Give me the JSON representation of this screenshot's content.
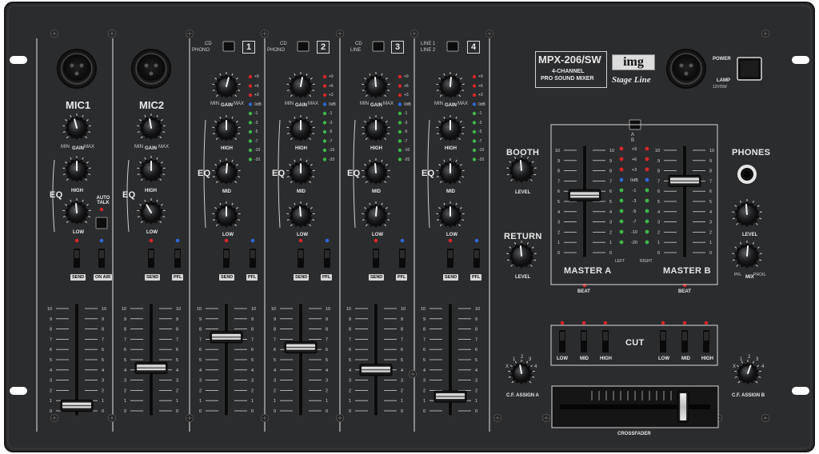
{
  "device": {
    "model": "MPX-206/SW",
    "subtitle_line1": "4-CHANNEL",
    "subtitle_line2": "PRO SOUND MIXER",
    "brand_logo": "img",
    "brand_script": "Stage Line",
    "power_label": "POWER",
    "lamp_label": "LAMP",
    "lamp_spec": "12V/5W"
  },
  "mic_channels": [
    {
      "name": "MIC1",
      "gain": "GAIN",
      "min": "MIN",
      "max": "MAX",
      "eq": "EQ",
      "high": "HIGH",
      "low": "LOW",
      "send": "SEND",
      "switch2": "ON AIR",
      "fader_level": 0.05
    },
    {
      "name": "MIC2",
      "gain": "GAIN",
      "min": "MIN",
      "max": "MAX",
      "eq": "EQ",
      "high": "HIGH",
      "low": "LOW",
      "send": "SEND",
      "switch2": "PFL",
      "fader_level": 0.42
    }
  ],
  "auto_talk": "AUTO TALK",
  "line_channels": [
    {
      "number": "1",
      "src_a": "CD",
      "src_b": "PHONO",
      "fader_level": 0.72
    },
    {
      "number": "2",
      "src_a": "CD",
      "src_b": "PHONO",
      "fader_level": 0.62
    },
    {
      "number": "3",
      "src_a": "CD",
      "src_b": "LINE",
      "fader_level": 0.4
    },
    {
      "number": "4",
      "src_a": "LINE 1",
      "src_b": "LINE 2",
      "fader_level": 0.14
    }
  ],
  "line_labels": {
    "gain": "GAIN",
    "min": "MIN",
    "max": "MAX",
    "eq": "EQ",
    "high": "HIGH",
    "mid": "MID",
    "low": "LOW",
    "send": "SEND",
    "pfl": "PFL"
  },
  "channel_meter_labels": [
    "+9",
    "+6",
    "+3",
    "0dB",
    "-1",
    "-3",
    "-5",
    "-7",
    "-10",
    "-20"
  ],
  "fader_scale": [
    "10",
    "9",
    "8",
    "7",
    "6",
    "5",
    "4",
    "3",
    "2",
    "1",
    "0"
  ],
  "booth": {
    "label": "BOOTH",
    "level": "LEVEL"
  },
  "return": {
    "label": "RETURN",
    "level": "LEVEL"
  },
  "phones": {
    "label": "PHONES",
    "level": "LEVEL",
    "mix": "MIX",
    "pfl": "PFL",
    "prog": "PROG."
  },
  "master": {
    "a_label": "MASTER A",
    "b_label": "MASTER B",
    "beat": "BEAT",
    "switch_a": "A",
    "switch_b": "B",
    "meter_left": "LEFT",
    "meter_right": "RIGHT",
    "meter_labels": [
      "+9",
      "+6",
      "+3",
      "0dB",
      "-1",
      "-3",
      "-5",
      "-7",
      "-10",
      "-20"
    ],
    "a_level": 0.56,
    "b_level": 0.7
  },
  "cut": {
    "label": "CUT",
    "buttons": [
      "LOW",
      "MID",
      "HIGH",
      "LOW",
      "MID",
      "HIGH"
    ]
  },
  "cf_assign_a": {
    "label": "C.F. ASSIGN A",
    "positions": [
      "X",
      "1",
      "2",
      "3",
      "4"
    ]
  },
  "cf_assign_b": {
    "label": "C.F. ASSIGN B",
    "positions": [
      "X",
      "1",
      "2",
      "3",
      "4"
    ]
  },
  "crossfader": {
    "label": "CROSSFADER",
    "position": 0.82
  },
  "colors": {
    "panel": "#2b2c2e",
    "panel_edge": "#1a1b1c",
    "text": "#e8e8e8",
    "led_red": "#d8262a",
    "led_green": "#3fb64a",
    "led_blue": "#2f68d8",
    "cap": "#d9d9d9"
  }
}
